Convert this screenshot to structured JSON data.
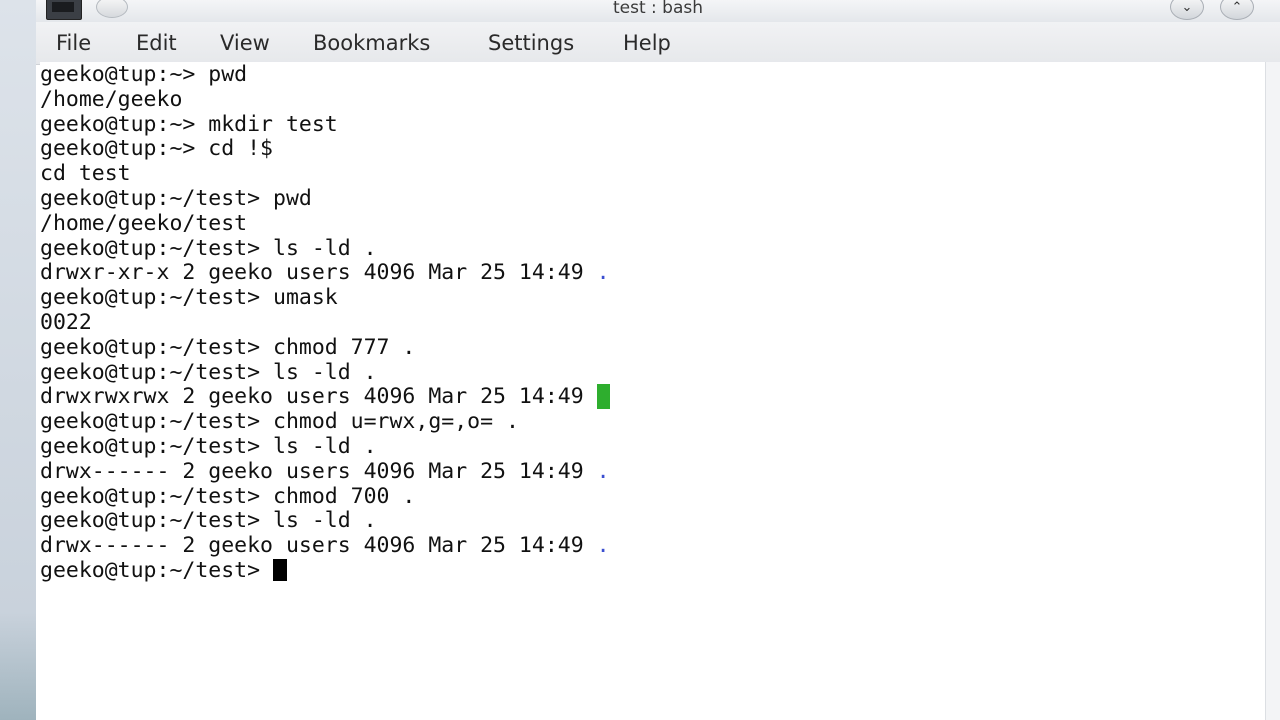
{
  "window": {
    "title": "test : bash",
    "minimize_glyph": "⌄",
    "maximize_glyph": "⌃"
  },
  "menu": [
    "File",
    "Edit",
    "View",
    "Bookmarks",
    "Settings",
    "Help"
  ],
  "terminal": {
    "lines": [
      {
        "text": "geeko@tup:~> pwd"
      },
      {
        "text": "/home/geeko"
      },
      {
        "text": "geeko@tup:~> mkdir test"
      },
      {
        "text": "geeko@tup:~> cd !$"
      },
      {
        "text": "cd test"
      },
      {
        "text": "geeko@tup:~/test> pwd"
      },
      {
        "text": "/home/geeko/test"
      },
      {
        "text": "geeko@tup:~/test> ls -ld ."
      },
      {
        "text": "drwxr-xr-x 2 geeko users 4096 Mar 25 14:49 ",
        "dir": ".",
        "dir_style": "blue"
      },
      {
        "text": "geeko@tup:~/test> umask"
      },
      {
        "text": "0022"
      },
      {
        "text": "geeko@tup:~/test> chmod 777 ."
      },
      {
        "text": "geeko@tup:~/test> ls -ld ."
      },
      {
        "text": "drwxrwxrwx 2 geeko users 4096 Mar 25 14:49 ",
        "dir": ".",
        "dir_style": "green"
      },
      {
        "text": "geeko@tup:~/test> chmod u=rwx,g=,o= ."
      },
      {
        "text": "geeko@tup:~/test> ls -ld ."
      },
      {
        "text": "drwx------ 2 geeko users 4096 Mar 25 14:49 ",
        "dir": ".",
        "dir_style": "blue"
      },
      {
        "text": "geeko@tup:~/test> chmod 700 ."
      },
      {
        "text": "geeko@tup:~/test> ls -ld ."
      },
      {
        "text": "drwx------ 2 geeko users 4096 Mar 25 14:49 ",
        "dir": ".",
        "dir_style": "blue"
      }
    ],
    "prompt": "geeko@tup:~/test> "
  },
  "colors": {
    "dir_blue": "#3b4fd0",
    "dir_green_bg": "#2eae2e",
    "cursor": "#000000"
  }
}
